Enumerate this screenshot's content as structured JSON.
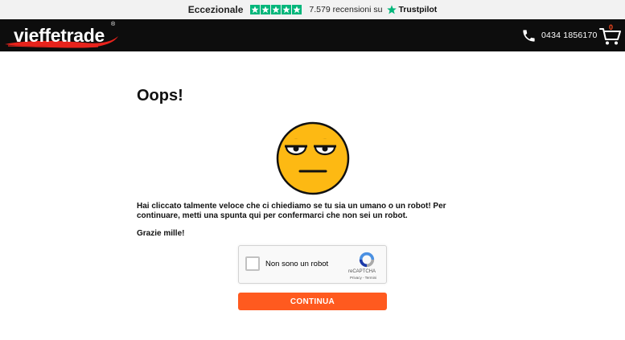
{
  "trustpilot": {
    "rating_label": "Eccezionale",
    "reviews_text": "7.579 recensioni su",
    "brand": "Trustpilot",
    "star_color": "#00b67a",
    "stars": 5
  },
  "header": {
    "logo_text": "vieffetrade",
    "logo_mark": "®",
    "phone": "0434 1856170",
    "cart_count": "0",
    "accent_color": "#ff4b1f"
  },
  "content": {
    "title": "Oops!",
    "message": "Hai cliccato talmente veloce che ci chiediamo se tu sia un umano o un robot! Per continuare, metti una spunta qui per confermarci che non sei un robot.",
    "thanks": "Grazie mille!"
  },
  "recaptcha": {
    "label": "Non sono un robot",
    "brand": "reCAPTCHA",
    "links": "Privacy - Termini"
  },
  "continue_button": {
    "label": "CONTINUA",
    "color": "#ff5a1f"
  }
}
